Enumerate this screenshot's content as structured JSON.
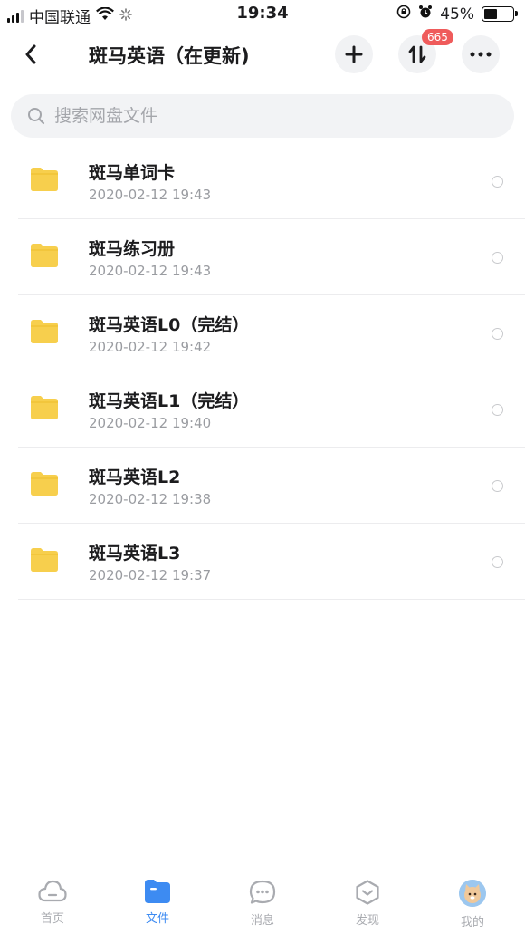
{
  "status_bar": {
    "carrier": "中国联通",
    "time": "19:34",
    "battery": "45%",
    "battery_level": 0.45
  },
  "nav": {
    "title": "斑马英语（在更新)",
    "transfer_badge": "665"
  },
  "search": {
    "placeholder": "搜索网盘文件"
  },
  "files": [
    {
      "name": "斑马单词卡",
      "date": "2020-02-12 19:43"
    },
    {
      "name": "斑马练习册",
      "date": "2020-02-12 19:43"
    },
    {
      "name": "斑马英语L0（完结）",
      "date": "2020-02-12 19:42"
    },
    {
      "name": "斑马英语L1（完结）",
      "date": "2020-02-12 19:40"
    },
    {
      "name": "斑马英语L2",
      "date": "2020-02-12 19:38"
    },
    {
      "name": "斑马英语L3",
      "date": "2020-02-12 19:37"
    }
  ],
  "tabs": [
    {
      "label": "首页",
      "icon": "cloud-icon"
    },
    {
      "label": "文件",
      "icon": "folder-icon",
      "active": true
    },
    {
      "label": "消息",
      "icon": "chat-bubble-icon"
    },
    {
      "label": "发现",
      "icon": "discover-icon"
    },
    {
      "label": "我的",
      "icon": "avatar"
    }
  ],
  "colors": {
    "accent": "#3d8bf2",
    "folder": "#f7cf4d",
    "badge": "#ef5b5b"
  }
}
